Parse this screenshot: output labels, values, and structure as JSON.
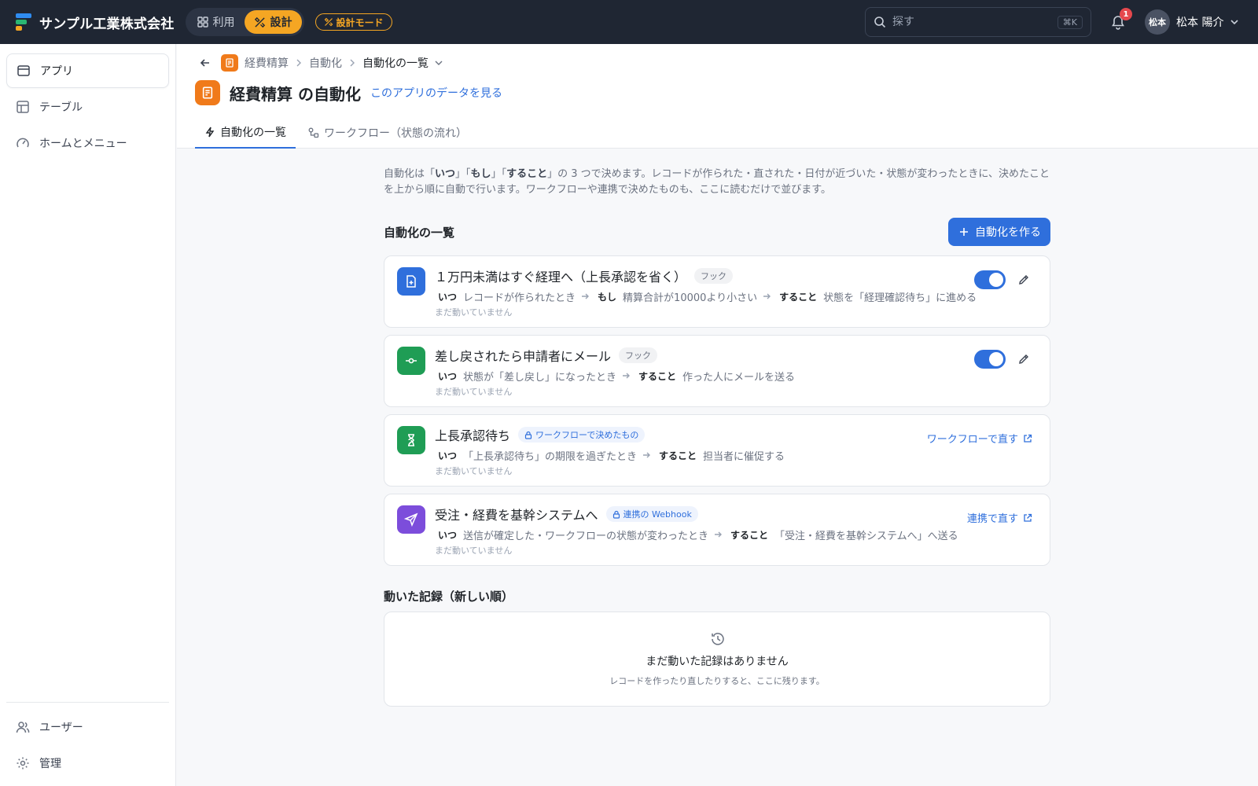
{
  "app": {
    "company": "サンプル工業株式会社"
  },
  "mode": {
    "use_label": "利用",
    "design_label": "設計",
    "badge_label": "設計モード"
  },
  "search": {
    "placeholder": "探す",
    "shortcut": "⌘K"
  },
  "notifications": {
    "count": "1"
  },
  "user": {
    "avatar_text": "松本",
    "name": "松本 陽介"
  },
  "sidebar": {
    "items": [
      {
        "label": "アプリ",
        "icon": "app-window-icon",
        "active": true
      },
      {
        "label": "テーブル",
        "icon": "table-icon"
      },
      {
        "label": "ホームとメニュー",
        "icon": "gauge-icon"
      }
    ],
    "bottom_items": [
      {
        "label": "ユーザー",
        "icon": "users-icon"
      },
      {
        "label": "管理",
        "icon": "gear-icon"
      }
    ]
  },
  "breadcrumb": {
    "app": "経費精算",
    "section": "自動化",
    "current": "自動化の一覧"
  },
  "header": {
    "title": "経費精算 の自動化",
    "data_link": "このアプリのデータを見る"
  },
  "tabs": [
    {
      "label": "自動化の一覧",
      "active": true
    },
    {
      "label": "ワークフロー（状態の流れ）"
    }
  ],
  "intro": {
    "p1": "自動化は「",
    "k1": "いつ",
    "p2": "」「",
    "k2": "もし",
    "p3": "」「",
    "k3": "すること",
    "p4": "」の 3 つで決めます。レコードが作られた・直された・日付が近づいた・状態が変わったときに、決めたことを上から順に自動で行います。ワークフローや連携で決めたものも、ここに読むだけで並びます。"
  },
  "list_section": {
    "title": "自動化の一覧",
    "create_label": "自動化を作る"
  },
  "keywords": {
    "when": "いつ",
    "if": "もし",
    "do": "すること"
  },
  "automations": [
    {
      "name": "１万円未満はすぐ経理へ（上長承認を省く）",
      "tag": "フック",
      "when": "レコードが作られたとき",
      "if": "精算合計が10000より小さい",
      "do": "状態を「経理確認待ち」に進める",
      "status": "まだ動いていません",
      "icon": "file-plus-icon",
      "icon_color": "#2f6fdc",
      "enabled": true
    },
    {
      "name": "差し戻されたら申請者にメール",
      "tag": "フック",
      "when": "状態が「差し戻し」になったとき",
      "do": "作った人にメールを送る",
      "status": "まだ動いていません",
      "icon": "commit-icon",
      "icon_color": "#1f9d55",
      "enabled": true
    },
    {
      "name": "上長承認待ち",
      "tag": "ワークフローで決めたもの",
      "when": "「上長承認待ち」の期限を過ぎたとき",
      "do": "担当者に催促する",
      "status": "まだ動いていません",
      "icon": "hourglass-icon",
      "icon_color": "#1f9d55",
      "link": "ワークフローで直す"
    },
    {
      "name": "受注・経費を基幹システムへ",
      "tag": "連携の Webhook",
      "when": "送信が確定した・ワークフローの状態が変わったとき",
      "do": "「受注・経費を基幹システムへ」へ送る",
      "status": "まだ動いていません",
      "icon": "send-icon",
      "icon_color": "#7c4ddb",
      "link": "連携で直す"
    }
  ],
  "history": {
    "title": "動いた記録（新しい順）",
    "empty_title": "まだ動いた記録はありません",
    "empty_sub": "レコードを作ったり直したりすると、ここに残ります。"
  }
}
